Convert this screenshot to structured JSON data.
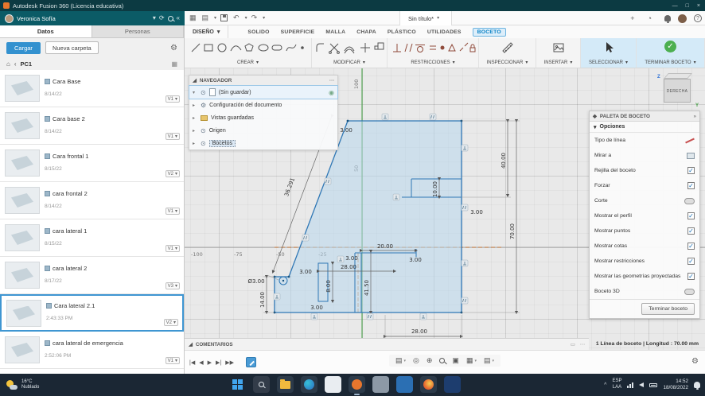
{
  "app": {
    "title": "Autodesk Fusion 360 (Licencia educativa)"
  },
  "colors": {
    "accent_blue": "#0696d7",
    "fusion_orange": "#e8762d",
    "check_green": "#4caf50",
    "titlebar": "#0c3a42",
    "header_teal": "#0b5b66",
    "taskbar": "#1b2734",
    "sketch_blue": "#2f77b5"
  },
  "icons": {
    "caret": "▾",
    "caret_right": "▸",
    "tree_open": "◢",
    "dots": "⋯",
    "eye": "⊙",
    "gear": "⚙",
    "home": "⌂",
    "back": "‹",
    "grid": "▦",
    "view_list": "▤",
    "refresh": "⟳",
    "collapse": "«",
    "min": "—",
    "max": "□",
    "close": "×",
    "plus": "+",
    "clock": "◔",
    "help": "?",
    "double_right": "»",
    "diamond": "◆",
    "radio": "◉",
    "undo": "↶",
    "redo": "↷",
    "orbit": "◎",
    "pan": "⊕",
    "fit": "▣",
    "display": "▤",
    "grid_menu": "▦",
    "chevron_up": "^",
    "comment_box": "▭"
  },
  "topbar": {
    "doc_tab": "Sin título*",
    "user": "Veronica Sofía"
  },
  "left_panel": {
    "tabs": [
      "Datos",
      "Personas"
    ],
    "upload": "Cargar",
    "new_folder": "Nueva carpeta",
    "location": "PC1",
    "items": [
      {
        "name": "Cara Base",
        "meta": "8/14/22",
        "version": "V1"
      },
      {
        "name": "Cara base 2",
        "meta": "8/14/22",
        "version": "V1"
      },
      {
        "name": "Cara frontal 1",
        "meta": "8/15/22",
        "version": "V2"
      },
      {
        "name": "cara frontal 2",
        "meta": "8/14/22",
        "version": "V1"
      },
      {
        "name": "cara lateral 1",
        "meta": "8/15/22",
        "version": "V1"
      },
      {
        "name": "cara lateral 2",
        "meta": "8/17/22",
        "version": "V3"
      },
      {
        "name": "Cara lateral 2.1",
        "meta": "2:43:33 PM",
        "version": "V2"
      },
      {
        "name": "cara lateral de emergencia",
        "meta": "2:52:06 PM",
        "version": "V1"
      }
    ]
  },
  "ribbon": {
    "workspace": "DISEÑO",
    "tabs": [
      "SOLIDO",
      "SUPERFICIE",
      "MALLA",
      "CHAPA",
      "PLÁSTICO",
      "UTILIDADES",
      "BOCETO"
    ],
    "groups": [
      "CREAR",
      "MODIFICAR",
      "RESTRICCIONES",
      "INSPECCIONAR",
      "INSERTAR",
      "SELECCIONAR",
      "TERMINAR BOCETO"
    ]
  },
  "navigator": {
    "title": "NAVEGADOR",
    "document": "(Sin guardar)",
    "items": [
      "Configuración del documento",
      "Vistas guardadas",
      "Origen",
      "Bocetos"
    ]
  },
  "viewcube": {
    "face": "DERECHA"
  },
  "palette": {
    "title": "PALETA DE BOCETO",
    "section": "Opciones",
    "rows": [
      {
        "label": "Tipo de línea",
        "state": "icon"
      },
      {
        "label": "Mirar a",
        "state": "icon"
      },
      {
        "label": "Rejilla del boceto",
        "state": "on"
      },
      {
        "label": "Forzar",
        "state": "on"
      },
      {
        "label": "Corte",
        "state": "off"
      },
      {
        "label": "Mostrar el perfil",
        "state": "on"
      },
      {
        "label": "Mostrar puntos",
        "state": "on"
      },
      {
        "label": "Mostrar cotas",
        "state": "on"
      },
      {
        "label": "Mostrar restricciones",
        "state": "on"
      },
      {
        "label": "Mostrar las geometrías proyectadas",
        "state": "on"
      },
      {
        "label": "Boceto 3D",
        "state": "off"
      }
    ],
    "finish_button": "Terminar boceto"
  },
  "comments": {
    "title": "COMENTARIOS"
  },
  "timeline": {
    "buttons": [
      "|◀",
      "◀",
      "▶",
      "▶|",
      "▶▶"
    ]
  },
  "status": {
    "selection_info": "1 Línea de boceto | Longitud : 70.00 mm"
  },
  "sketch": {
    "dims": [
      "36.291",
      "40.00",
      "10.00",
      "3.00",
      "70.00",
      "20.00",
      "3.00",
      "3.00",
      "28.00",
      "41.50",
      "Ø3.00",
      "3.00",
      "8.00",
      "14.00",
      "3.00",
      "28.00",
      "3.00"
    ],
    "axis_labels": [
      "100",
      "50",
      "-100",
      "-75",
      "-50",
      "-25"
    ]
  },
  "taskbar": {
    "weather_temp": "16°C",
    "weather_desc": "Nublado",
    "lang_top": "ESP",
    "lang_bottom": "LAA",
    "time": "14:52",
    "date": "18/08/2022"
  }
}
